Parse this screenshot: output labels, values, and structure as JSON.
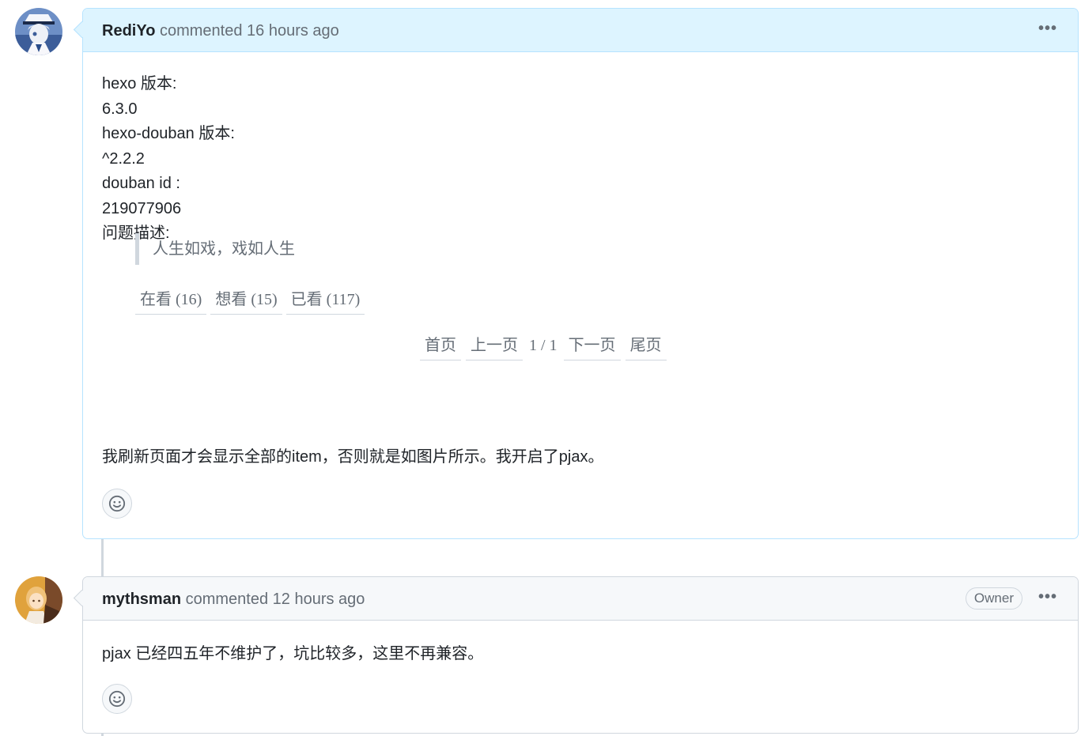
{
  "comments": [
    {
      "author": "RediYo",
      "action": "commented",
      "time": "16 hours ago",
      "more_label": "•••",
      "lines": [
        "hexo 版本:",
        "6.3.0",
        "hexo-douban 版本:",
        "^2.2.2",
        "douban id :",
        "219077906",
        "问题描述:"
      ],
      "screenshot": {
        "quote": "人生如戏，戏如人生",
        "tabs": [
          "在看 (16)",
          "想看 (15)",
          "已看 (117)"
        ],
        "pager": {
          "first": "首页",
          "prev": "上一页",
          "page": "1 / 1",
          "next": "下一页",
          "last": "尾页"
        }
      },
      "description": "我刷新页面才会显示全部的item，否则就是如图片所示。我开启了pjax。",
      "reaction_icon": "smiley-icon"
    },
    {
      "author": "mythsman",
      "action": "commented",
      "time": "12 hours ago",
      "badge": "Owner",
      "more_label": "•••",
      "text": "pjax 已经四五年不维护了，坑比较多，这里不再兼容。",
      "reaction_icon": "smiley-icon"
    }
  ],
  "colors": {
    "highlight_header": "#ddf4ff",
    "highlight_border": "#b6e3ff",
    "header_bg": "#f6f8fa",
    "border": "#d0d7de",
    "muted_text": "#656d76"
  }
}
